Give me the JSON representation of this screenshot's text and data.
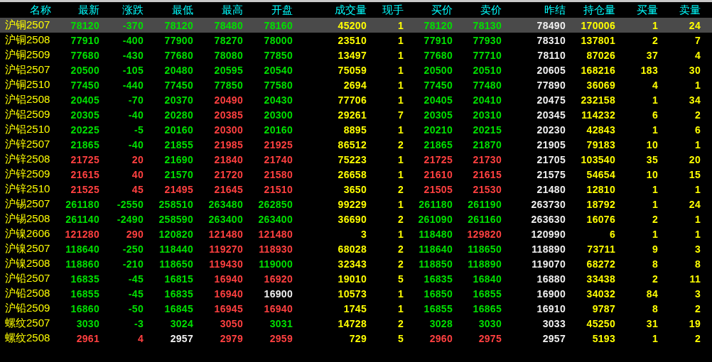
{
  "columns": [
    "名称",
    "最新",
    "涨跌",
    "最低",
    "最高",
    "开盘",
    "成交量",
    "现手",
    "买价",
    "卖价",
    "昨结",
    "持仓量",
    "买量",
    "卖量"
  ],
  "rows": [
    {
      "name": "沪铜2507",
      "selected": true,
      "values": [
        {
          "text": "78120",
          "color": "#00e000"
        },
        {
          "text": "-370",
          "color": "#00e000"
        },
        {
          "text": "78120",
          "color": "#00e000"
        },
        {
          "text": "78480",
          "color": "#00e000"
        },
        {
          "text": "78160",
          "color": "#00e000"
        },
        "45200",
        "1",
        {
          "text": "78120",
          "color": "#00e000"
        },
        {
          "text": "78130",
          "color": "#00e000"
        },
        "78490",
        "170006",
        "1",
        "24"
      ]
    },
    {
      "name": "沪铜2508",
      "selected": false,
      "values": [
        {
          "text": "77910",
          "color": "#00e000"
        },
        {
          "text": "-400",
          "color": "#00e000"
        },
        {
          "text": "77900",
          "color": "#00e000"
        },
        {
          "text": "78270",
          "color": "#00e000"
        },
        {
          "text": "78000",
          "color": "#00e000"
        },
        "23510",
        "1",
        {
          "text": "77910",
          "color": "#00e000"
        },
        {
          "text": "77930",
          "color": "#00e000"
        },
        "78310",
        "137801",
        "2",
        "7"
      ]
    },
    {
      "name": "沪铜2509",
      "selected": false,
      "values": [
        {
          "text": "77680",
          "color": "#00e000"
        },
        {
          "text": "-430",
          "color": "#00e000"
        },
        {
          "text": "77680",
          "color": "#00e000"
        },
        {
          "text": "78080",
          "color": "#00e000"
        },
        {
          "text": "77850",
          "color": "#00e000"
        },
        "13497",
        "1",
        {
          "text": "77680",
          "color": "#00e000"
        },
        {
          "text": "77710",
          "color": "#00e000"
        },
        "78110",
        "87026",
        "37",
        "4"
      ]
    },
    {
      "name": "沪铝2507",
      "selected": false,
      "values": [
        {
          "text": "20500",
          "color": "#00e000"
        },
        {
          "text": "-105",
          "color": "#00e000"
        },
        {
          "text": "20480",
          "color": "#00e000"
        },
        {
          "text": "20595",
          "color": "#00e000"
        },
        {
          "text": "20540",
          "color": "#00e000"
        },
        "75059",
        "1",
        {
          "text": "20500",
          "color": "#00e000"
        },
        {
          "text": "20510",
          "color": "#00e000"
        },
        "20605",
        "168216",
        "183",
        "30"
      ]
    },
    {
      "name": "沪铜2510",
      "selected": false,
      "values": [
        {
          "text": "77450",
          "color": "#00e000"
        },
        {
          "text": "-440",
          "color": "#00e000"
        },
        {
          "text": "77450",
          "color": "#00e000"
        },
        {
          "text": "77850",
          "color": "#00e000"
        },
        {
          "text": "77580",
          "color": "#00e000"
        },
        "2694",
        "1",
        {
          "text": "77450",
          "color": "#00e000"
        },
        {
          "text": "77480",
          "color": "#00e000"
        },
        "77890",
        "36069",
        "4",
        "1"
      ]
    },
    {
      "name": "沪铝2508",
      "selected": false,
      "values": [
        {
          "text": "20405",
          "color": "#00e000"
        },
        {
          "text": "-70",
          "color": "#00e000"
        },
        {
          "text": "20370",
          "color": "#00e000"
        },
        {
          "text": "20490",
          "color": "#ff4040"
        },
        {
          "text": "20430",
          "color": "#00e000"
        },
        "77706",
        "1",
        {
          "text": "20405",
          "color": "#00e000"
        },
        {
          "text": "20410",
          "color": "#00e000"
        },
        "20475",
        "232158",
        "1",
        "34"
      ]
    },
    {
      "name": "沪铝2509",
      "selected": false,
      "values": [
        {
          "text": "20305",
          "color": "#00e000"
        },
        {
          "text": "-40",
          "color": "#00e000"
        },
        {
          "text": "20280",
          "color": "#00e000"
        },
        {
          "text": "20385",
          "color": "#ff4040"
        },
        {
          "text": "20300",
          "color": "#00e000"
        },
        "29261",
        "7",
        {
          "text": "20305",
          "color": "#00e000"
        },
        {
          "text": "20310",
          "color": "#00e000"
        },
        "20345",
        "114232",
        "6",
        "2"
      ]
    },
    {
      "name": "沪铝2510",
      "selected": false,
      "values": [
        {
          "text": "20225",
          "color": "#00e000"
        },
        {
          "text": "-5",
          "color": "#00e000"
        },
        {
          "text": "20160",
          "color": "#00e000"
        },
        {
          "text": "20300",
          "color": "#ff4040"
        },
        {
          "text": "20160",
          "color": "#00e000"
        },
        "8895",
        "1",
        {
          "text": "20210",
          "color": "#00e000"
        },
        {
          "text": "20215",
          "color": "#00e000"
        },
        "20230",
        "42843",
        "1",
        "6"
      ]
    },
    {
      "name": "沪锌2507",
      "selected": false,
      "values": [
        {
          "text": "21865",
          "color": "#00e000"
        },
        {
          "text": "-40",
          "color": "#00e000"
        },
        {
          "text": "21855",
          "color": "#00e000"
        },
        {
          "text": "21985",
          "color": "#ff4040"
        },
        {
          "text": "21925",
          "color": "#ff4040"
        },
        "86512",
        "2",
        {
          "text": "21865",
          "color": "#00e000"
        },
        {
          "text": "21870",
          "color": "#00e000"
        },
        "21905",
        "79183",
        "10",
        "1"
      ]
    },
    {
      "name": "沪锌2508",
      "selected": false,
      "values": [
        {
          "text": "21725",
          "color": "#ff4040"
        },
        {
          "text": "20",
          "color": "#ff4040"
        },
        {
          "text": "21690",
          "color": "#00e000"
        },
        {
          "text": "21840",
          "color": "#ff4040"
        },
        {
          "text": "21740",
          "color": "#ff4040"
        },
        "75223",
        "1",
        {
          "text": "21725",
          "color": "#ff4040"
        },
        {
          "text": "21730",
          "color": "#ff4040"
        },
        "21705",
        "103540",
        "35",
        "20"
      ]
    },
    {
      "name": "沪锌2509",
      "selected": false,
      "values": [
        {
          "text": "21615",
          "color": "#ff4040"
        },
        {
          "text": "40",
          "color": "#ff4040"
        },
        {
          "text": "21570",
          "color": "#00e000"
        },
        {
          "text": "21720",
          "color": "#ff4040"
        },
        {
          "text": "21580",
          "color": "#ff4040"
        },
        "26658",
        "1",
        {
          "text": "21610",
          "color": "#ff4040"
        },
        {
          "text": "21615",
          "color": "#ff4040"
        },
        "21575",
        "54654",
        "10",
        "15"
      ]
    },
    {
      "name": "沪锌2510",
      "selected": false,
      "values": [
        {
          "text": "21525",
          "color": "#ff4040"
        },
        {
          "text": "45",
          "color": "#ff4040"
        },
        {
          "text": "21495",
          "color": "#ff4040"
        },
        {
          "text": "21645",
          "color": "#ff4040"
        },
        {
          "text": "21510",
          "color": "#ff4040"
        },
        "3650",
        "2",
        {
          "text": "21505",
          "color": "#ff4040"
        },
        {
          "text": "21530",
          "color": "#ff4040"
        },
        "21480",
        "12810",
        "1",
        "1"
      ]
    },
    {
      "name": "沪锡2507",
      "selected": false,
      "values": [
        {
          "text": "261180",
          "color": "#00e000"
        },
        {
          "text": "-2550",
          "color": "#00e000"
        },
        {
          "text": "258510",
          "color": "#00e000"
        },
        {
          "text": "263480",
          "color": "#00e000"
        },
        {
          "text": "262850",
          "color": "#00e000"
        },
        "99229",
        "1",
        {
          "text": "261180",
          "color": "#00e000"
        },
        {
          "text": "261190",
          "color": "#00e000"
        },
        "263730",
        "18792",
        "1",
        "24"
      ]
    },
    {
      "name": "沪锡2508",
      "selected": false,
      "values": [
        {
          "text": "261140",
          "color": "#00e000"
        },
        {
          "text": "-2490",
          "color": "#00e000"
        },
        {
          "text": "258590",
          "color": "#00e000"
        },
        {
          "text": "263400",
          "color": "#00e000"
        },
        {
          "text": "263400",
          "color": "#00e000"
        },
        "36690",
        "2",
        {
          "text": "261090",
          "color": "#00e000"
        },
        {
          "text": "261160",
          "color": "#00e000"
        },
        "263630",
        "16076",
        "2",
        "1"
      ]
    },
    {
      "name": "沪镍2606",
      "selected": false,
      "values": [
        {
          "text": "121280",
          "color": "#ff4040"
        },
        {
          "text": "290",
          "color": "#ff4040"
        },
        {
          "text": "120820",
          "color": "#00e000"
        },
        {
          "text": "121480",
          "color": "#ff4040"
        },
        {
          "text": "121480",
          "color": "#ff4040"
        },
        "3",
        "1",
        {
          "text": "118480",
          "color": "#00e000"
        },
        {
          "text": "129820",
          "color": "#ff4040"
        },
        "120990",
        "6",
        "1",
        "1"
      ]
    },
    {
      "name": "沪镍2507",
      "selected": false,
      "values": [
        {
          "text": "118640",
          "color": "#00e000"
        },
        {
          "text": "-250",
          "color": "#00e000"
        },
        {
          "text": "118440",
          "color": "#00e000"
        },
        {
          "text": "119270",
          "color": "#ff4040"
        },
        {
          "text": "118930",
          "color": "#ff4040"
        },
        "68028",
        "2",
        {
          "text": "118640",
          "color": "#00e000"
        },
        {
          "text": "118650",
          "color": "#00e000"
        },
        "118890",
        "73711",
        "9",
        "3"
      ]
    },
    {
      "name": "沪镍2508",
      "selected": false,
      "values": [
        {
          "text": "118860",
          "color": "#00e000"
        },
        {
          "text": "-210",
          "color": "#00e000"
        },
        {
          "text": "118650",
          "color": "#00e000"
        },
        {
          "text": "119430",
          "color": "#ff4040"
        },
        {
          "text": "119000",
          "color": "#00e000"
        },
        "32343",
        "2",
        {
          "text": "118850",
          "color": "#00e000"
        },
        {
          "text": "118890",
          "color": "#00e000"
        },
        "119070",
        "68272",
        "8",
        "8"
      ]
    },
    {
      "name": "沪铅2507",
      "selected": false,
      "values": [
        {
          "text": "16835",
          "color": "#00e000"
        },
        {
          "text": "-45",
          "color": "#00e000"
        },
        {
          "text": "16815",
          "color": "#00e000"
        },
        {
          "text": "16940",
          "color": "#ff4040"
        },
        {
          "text": "16920",
          "color": "#ff4040"
        },
        "19010",
        "5",
        {
          "text": "16835",
          "color": "#00e000"
        },
        {
          "text": "16840",
          "color": "#00e000"
        },
        "16880",
        "33438",
        "2",
        "11"
      ]
    },
    {
      "name": "沪铅2508",
      "selected": false,
      "values": [
        {
          "text": "16855",
          "color": "#00e000"
        },
        {
          "text": "-45",
          "color": "#00e000"
        },
        {
          "text": "16835",
          "color": "#00e000"
        },
        {
          "text": "16940",
          "color": "#ff4040"
        },
        {
          "text": "16900",
          "color": "#f0f0f0"
        },
        "10573",
        "1",
        {
          "text": "16850",
          "color": "#00e000"
        },
        {
          "text": "16855",
          "color": "#00e000"
        },
        "16900",
        "34032",
        "84",
        "3"
      ]
    },
    {
      "name": "沪铅2509",
      "selected": false,
      "values": [
        {
          "text": "16860",
          "color": "#00e000"
        },
        {
          "text": "-50",
          "color": "#00e000"
        },
        {
          "text": "16845",
          "color": "#00e000"
        },
        {
          "text": "16945",
          "color": "#ff4040"
        },
        {
          "text": "16940",
          "color": "#ff4040"
        },
        "1745",
        "1",
        {
          "text": "16855",
          "color": "#00e000"
        },
        {
          "text": "16865",
          "color": "#00e000"
        },
        "16910",
        "9787",
        "8",
        "2"
      ]
    },
    {
      "name": "螺纹2507",
      "selected": false,
      "values": [
        {
          "text": "3030",
          "color": "#00e000"
        },
        {
          "text": "-3",
          "color": "#00e000"
        },
        {
          "text": "3024",
          "color": "#00e000"
        },
        {
          "text": "3050",
          "color": "#ff4040"
        },
        {
          "text": "3031",
          "color": "#00e000"
        },
        "14728",
        "2",
        {
          "text": "3028",
          "color": "#00e000"
        },
        {
          "text": "3030",
          "color": "#00e000"
        },
        "3033",
        "45250",
        "31",
        "19"
      ]
    },
    {
      "name": "螺纹2508",
      "selected": false,
      "values": [
        {
          "text": "2961",
          "color": "#ff4040"
        },
        {
          "text": "4",
          "color": "#ff4040"
        },
        {
          "text": "2957",
          "color": "#f0f0f0"
        },
        {
          "text": "2979",
          "color": "#ff4040"
        },
        {
          "text": "2959",
          "color": "#ff4040"
        },
        "729",
        "5",
        {
          "text": "2960",
          "color": "#ff4040"
        },
        {
          "text": "2975",
          "color": "#ff4040"
        },
        "2957",
        "5193",
        "1",
        "2"
      ]
    }
  ]
}
